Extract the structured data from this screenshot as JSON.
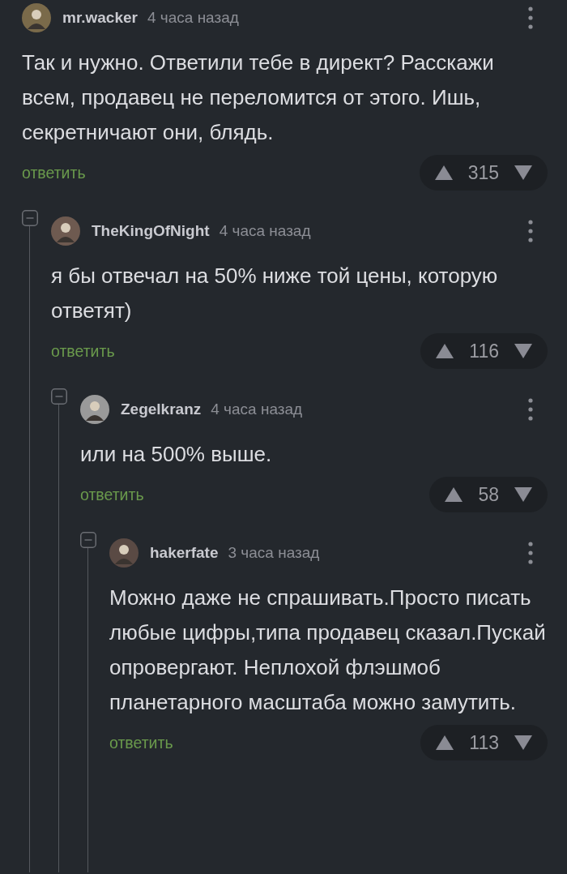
{
  "comments": [
    {
      "author": "mr.wacker",
      "time": "4 часа назад",
      "text": "Так и нужно. Ответили тебе в директ? Расскажи всем, продавец не переломится от этого. Ишь, секретничают они, блядь.",
      "reply": "ответить",
      "votes": "315",
      "children": [
        {
          "author": "TheKingOfNight",
          "time": "4 часа назад",
          "text": "я бы отвечал на 50% ниже той цены, которую ответят)",
          "reply": "ответить",
          "votes": "116",
          "children": [
            {
              "author": "Zegelkranz",
              "time": "4 часа назад",
              "text": "или на 500% выше.",
              "reply": "ответить",
              "votes": "58",
              "children": [
                {
                  "author": "hakerfate",
                  "time": "3 часа назад",
                  "text": "Можно даже не спрашивать.Просто писать любые цифры,типа продавец сказал.Пускай опровергают. Неплохой флэшмоб планетарного масштаба можно замутить.",
                  "reply": "ответить",
                  "votes": "113"
                }
              ]
            }
          ]
        }
      ]
    }
  ]
}
